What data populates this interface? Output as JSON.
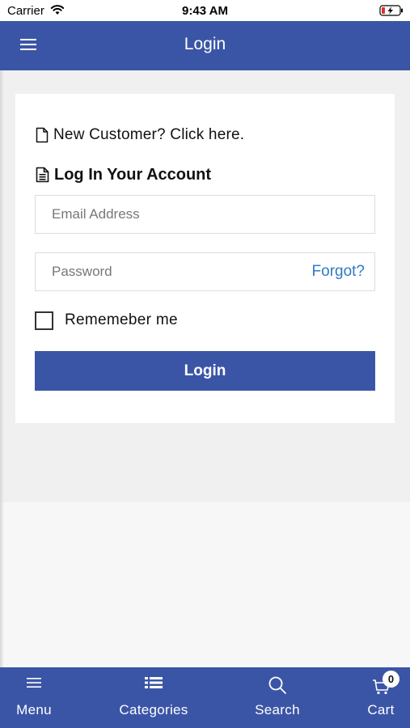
{
  "status_bar": {
    "carrier": "Carrier",
    "time": "9:43 AM",
    "wifi_icon": "wifi-icon",
    "battery_icon": "battery-charging-icon"
  },
  "header": {
    "menu_icon": "hamburger-menu-icon",
    "title": "Login"
  },
  "login_card": {
    "new_customer_icon": "document-icon",
    "new_customer_text": "New Customer? Click here.",
    "heading_icon": "document-lines-icon",
    "heading": "Log In Your Account",
    "email": {
      "value": "",
      "placeholder": "Email Address"
    },
    "password": {
      "value": "",
      "placeholder": "Password",
      "forgot_label": "Forgot?"
    },
    "remember_me": {
      "label": "Rememeber me",
      "checked": false
    },
    "login_button_label": "Login"
  },
  "tab_bar": {
    "tabs": [
      {
        "label": "Menu",
        "icon": "hamburger-menu-icon"
      },
      {
        "label": "Categories",
        "icon": "list-icon"
      },
      {
        "label": "Search",
        "icon": "search-icon"
      },
      {
        "label": "Cart",
        "icon": "cart-icon",
        "badge": "0"
      }
    ]
  },
  "colors": {
    "primary": "#3b55a6",
    "link": "#2f7ac4",
    "background": "#f0f0f0",
    "card": "#ffffff"
  }
}
